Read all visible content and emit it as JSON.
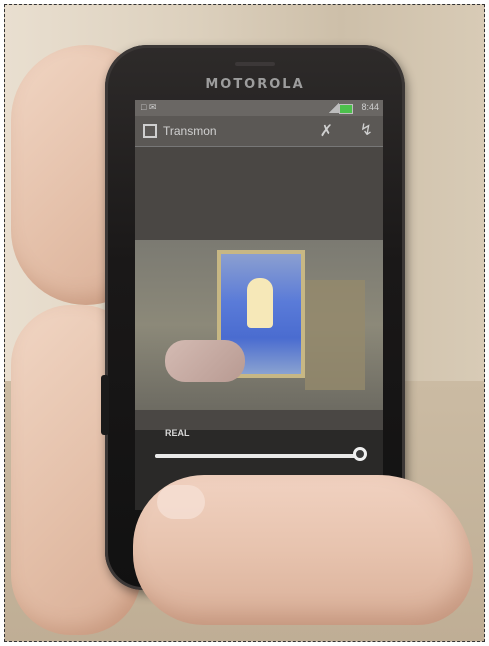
{
  "photo": {
    "device_brand": "MOTOROLA",
    "status_bar": {
      "left": "□ ✉",
      "time": "8:44"
    },
    "app_bar": {
      "title": "Transmon",
      "close_label": "✗",
      "share_label": "↯"
    },
    "bottom_controls": {
      "slider_label": "REAL",
      "slider_level_fraction": 1.0
    }
  }
}
